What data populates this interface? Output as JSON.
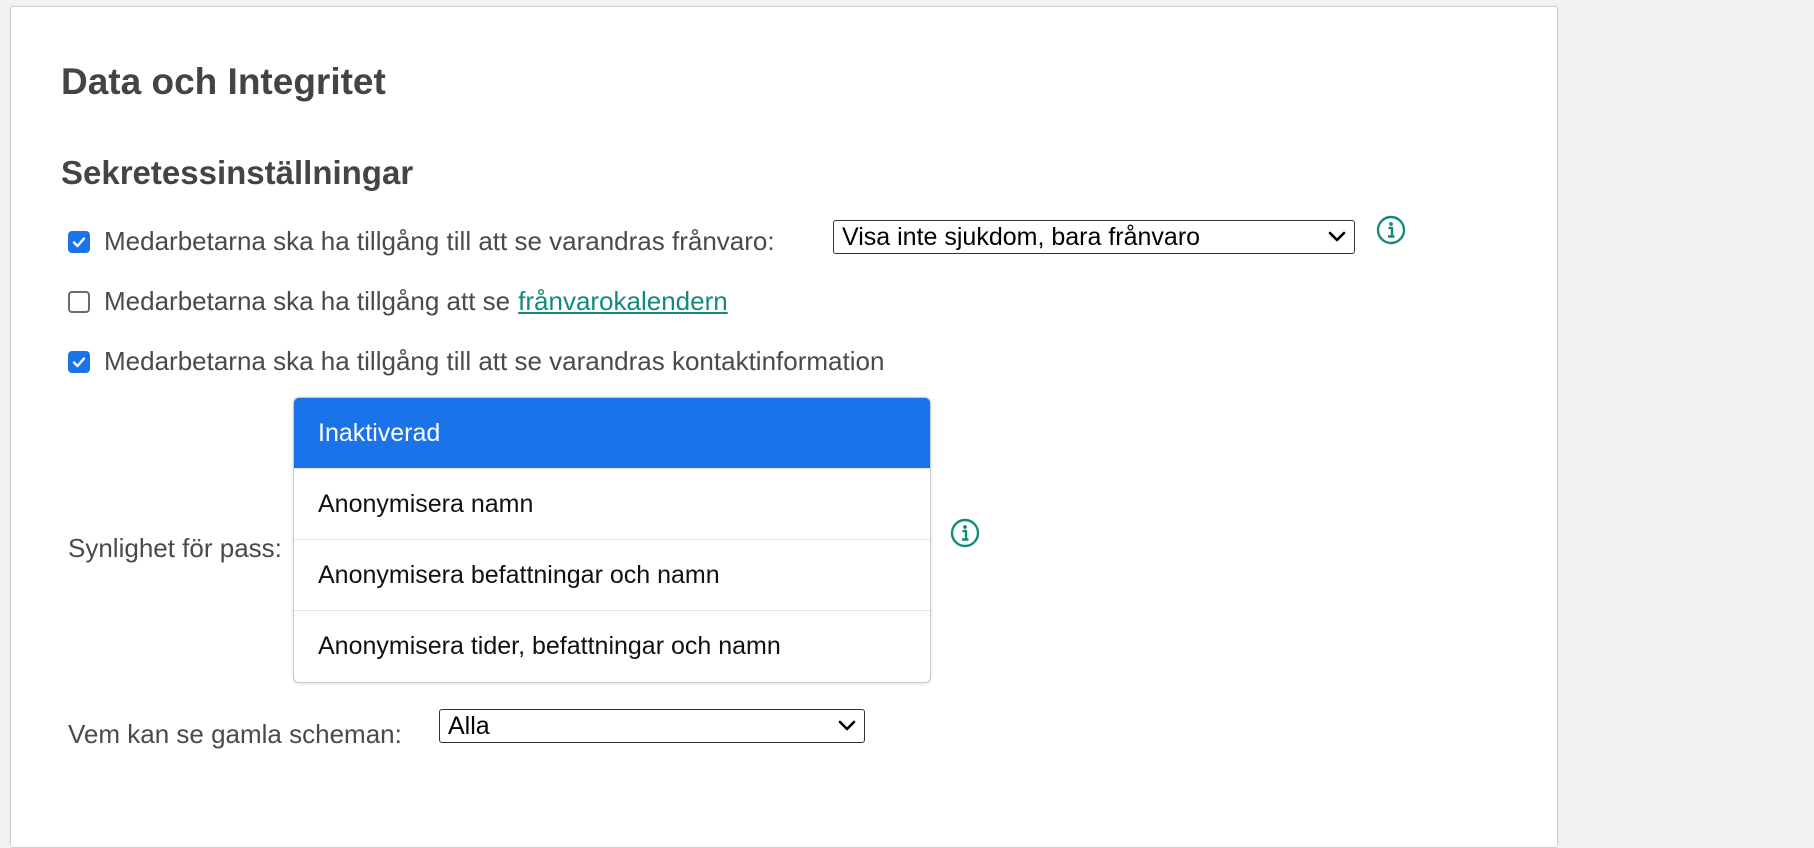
{
  "page": {
    "title": "Data och Integritet",
    "section_title": "Sekretessinställningar"
  },
  "settings": {
    "absence_visibility": {
      "checked": true,
      "label": "Medarbetarna ska ha tillgång till att se varandras frånvaro:",
      "selected_value": "Visa inte sjukdom, bara frånvaro"
    },
    "absence_calendar": {
      "checked": false,
      "label_prefix": "Medarbetarna ska ha tillgång att se",
      "link_text": "frånvarokalendern"
    },
    "contact_info": {
      "checked": true,
      "label": "Medarbetarna ska ha tillgång till att se varandras kontaktinformation"
    },
    "shift_visibility": {
      "label": "Synlighet för pass:",
      "options": [
        "Inaktiverad",
        "Anonymisera namn",
        "Anonymisera befattningar och namn",
        "Anonymisera tider, befattningar och namn"
      ],
      "highlighted_option": "Inaktiverad"
    },
    "old_schedules": {
      "label": "Vem kan se gamla scheman:",
      "selected_value": "Alla"
    }
  },
  "colors": {
    "accent": "#1a73e8",
    "link": "#138a7c",
    "info_icon": "#138a7c",
    "heading": "#444444"
  },
  "icons": {
    "info": "info-circle-icon",
    "checkmark": "checkmark-icon",
    "dropdown_arrow": "chevron-down-icon"
  }
}
